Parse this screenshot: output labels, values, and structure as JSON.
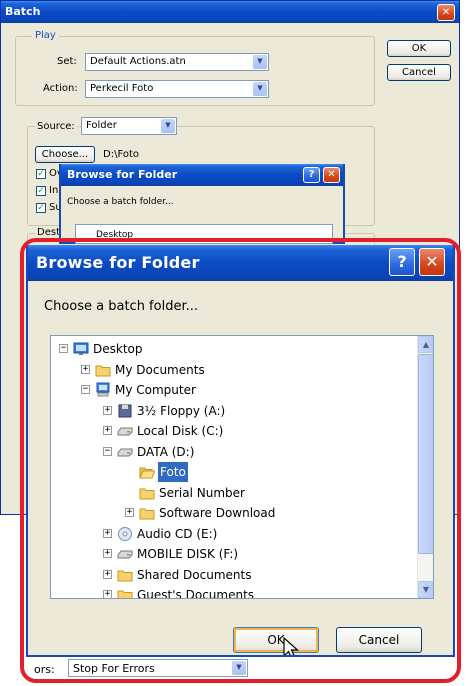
{
  "batch": {
    "title": "Batch",
    "play_legend": "Play",
    "set_label": "Set:",
    "set_value": "Default Actions.atn",
    "action_label": "Action:",
    "action_value": "Perkecil Foto",
    "ok_label": "OK",
    "cancel_label": "Cancel",
    "source_label": "Source:",
    "source_value": "Folder",
    "choose_label": "Choose...",
    "choose_path": "D:\\Foto",
    "check_partials": [
      "Ov",
      "In",
      "Su"
    ],
    "dest_partial": "Dest",
    "errors_partial": "ors:",
    "errors_value": "Stop For Errors"
  },
  "small_browse": {
    "title": "Browse for Folder",
    "help_glyph": "?",
    "close_glyph": "✕",
    "instruction": "Choose a batch folder...",
    "first_item": "Desktop"
  },
  "browse": {
    "title": "Browse for Folder",
    "help_glyph": "?",
    "close_glyph": "✕",
    "instruction": "Choose a batch folder...",
    "tree": [
      {
        "label": "Desktop",
        "icon": "desktop-icon",
        "expander": "−",
        "level": 0
      },
      {
        "label": "My Documents",
        "icon": "folder-icon",
        "expander": "+",
        "level": 1
      },
      {
        "label": "My Computer",
        "icon": "computer-icon",
        "expander": "−",
        "level": 1
      },
      {
        "label": "3½ Floppy (A:)",
        "icon": "floppy-icon",
        "expander": "+",
        "level": 2
      },
      {
        "label": "Local Disk (C:)",
        "icon": "disk-icon",
        "expander": "+",
        "level": 2
      },
      {
        "label": "DATA (D:)",
        "icon": "disk-icon",
        "expander": "−",
        "level": 2
      },
      {
        "label": "Foto",
        "icon": "open-folder-icon",
        "expander": "",
        "level": 3,
        "selected": true
      },
      {
        "label": "Serial Number",
        "icon": "folder-icon",
        "expander": "",
        "level": 3
      },
      {
        "label": "Software Download",
        "icon": "folder-icon",
        "expander": "+",
        "level": 3
      },
      {
        "label": "Audio CD (E:)",
        "icon": "cd-icon",
        "expander": "+",
        "level": 2
      },
      {
        "label": "MOBILE DISK (F:)",
        "icon": "disk-icon",
        "expander": "+",
        "level": 2
      },
      {
        "label": "Shared Documents",
        "icon": "folder-icon",
        "expander": "+",
        "level": 2
      },
      {
        "label": "Guest's Documents",
        "icon": "folder-icon",
        "expander": "+",
        "level": 2
      }
    ],
    "ok_label": "OK",
    "cancel_label": "Cancel"
  },
  "colors": {
    "title_bar": "#0b4bc5",
    "highlight_frame": "#e2202b",
    "selection": "#316ac5",
    "dialog_bg": "#ece9d8"
  }
}
